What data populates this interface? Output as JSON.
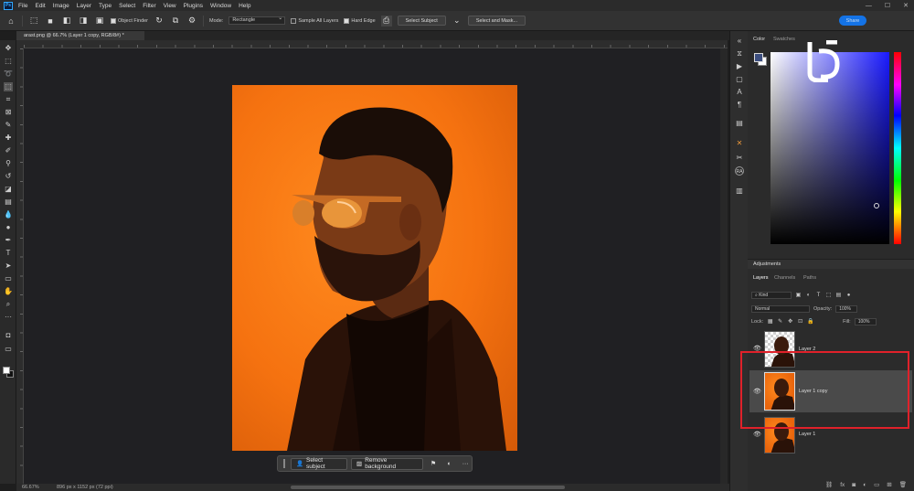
{
  "app": {
    "logo_text": "Ps",
    "menu": [
      "File",
      "Edit",
      "Image",
      "Layer",
      "Type",
      "Select",
      "Filter",
      "View",
      "Plugins",
      "Window",
      "Help"
    ],
    "window_controls": [
      "—",
      "☐",
      "✕"
    ],
    "share_label": "Share"
  },
  "options_bar": {
    "object_finder_label": "Object Finder",
    "mode_label": "Mode:",
    "mode_value": "Rectangle",
    "sample_all_layers_label": "Sample All Layers",
    "hard_edge_label": "Hard Edge",
    "select_subject_label": "Select Subject",
    "select_and_mask_label": "Select and Mask..."
  },
  "document": {
    "tab_title": "arast.png @ 66.7% (Layer 1 copy, RGB/8#) *",
    "canvas_color": "#f57210"
  },
  "context_bar": {
    "select_subject_label": "Select subject",
    "remove_background_label": "Remove background",
    "more_label": "···"
  },
  "status_bar": {
    "zoom": "66.67%",
    "doc_info": "896 px x 1152 px (72 ppi)"
  },
  "color_panel": {
    "tabs": [
      "Color",
      "Swatches"
    ],
    "foreground": "#3d4f80",
    "background": "#ffffff"
  },
  "adjustments": {
    "title": "Adjustments"
  },
  "layers_panel": {
    "tabs": [
      "Layers",
      "Channels",
      "Paths"
    ],
    "filter_label": "Kind",
    "blend_mode": "Normal",
    "opacity_label": "Opacity:",
    "opacity_value": "100%",
    "lock_label": "Lock:",
    "fill_label": "Fill:",
    "fill_value": "100%",
    "layers": [
      {
        "name": "Layer 2",
        "visible": true,
        "selected": false
      },
      {
        "name": "Layer 1 copy",
        "visible": true,
        "selected": true
      },
      {
        "name": "Layer 1",
        "visible": true,
        "selected": false
      }
    ],
    "footer_icons": [
      "link-icon",
      "fx-icon",
      "mask-icon",
      "adjustment-icon",
      "group-icon",
      "new-layer-icon",
      "delete-icon"
    ]
  },
  "highlight_color": "#e0212a"
}
